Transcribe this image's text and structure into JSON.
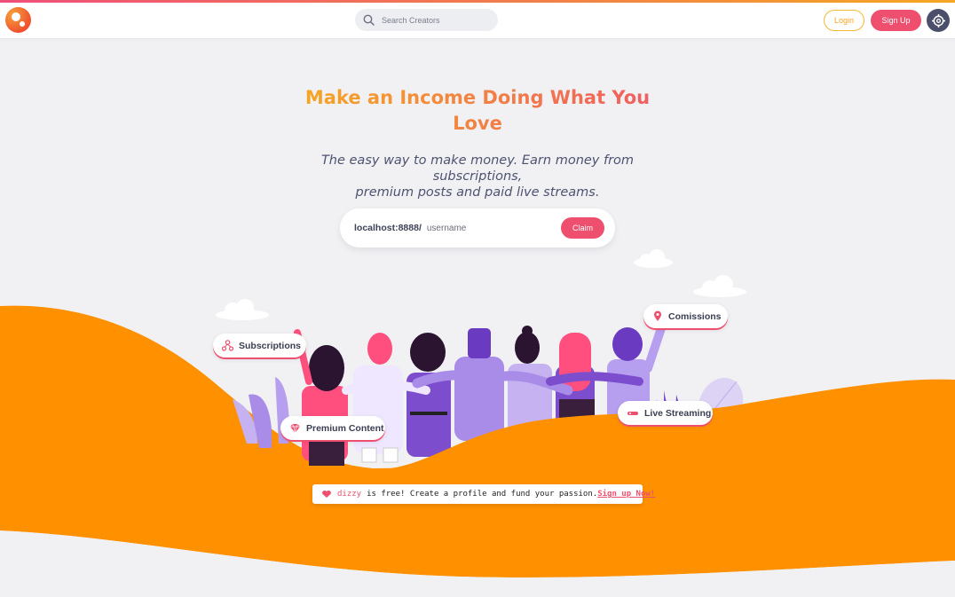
{
  "header": {
    "search_placeholder": "Search Creators",
    "login_label": "Login",
    "signup_label": "Sign Up"
  },
  "hero": {
    "title_line1": "Make an Income Doing What You",
    "title_line2": "Love",
    "subtitle_line1": "The easy way to make money. Earn money from subscriptions,",
    "subtitle_line2": "premium posts and paid live streams."
  },
  "claim": {
    "prefix": "localhost:8888/",
    "placeholder": "username",
    "button_label": "Claim"
  },
  "features": {
    "subscriptions": "Subscriptions",
    "premium": "Premium Content",
    "commissions": "Comissions",
    "live": "Live Streaming"
  },
  "banner": {
    "brand": "dizzy",
    "text": "is free! Create a profile and fund your passion.",
    "link": "Sign up Now!"
  },
  "colors": {
    "accent_pink": "#ef4f6e",
    "accent_orange": "#ff9100",
    "accent_yellow": "#f5a623",
    "purple": "#7c4dcc"
  }
}
